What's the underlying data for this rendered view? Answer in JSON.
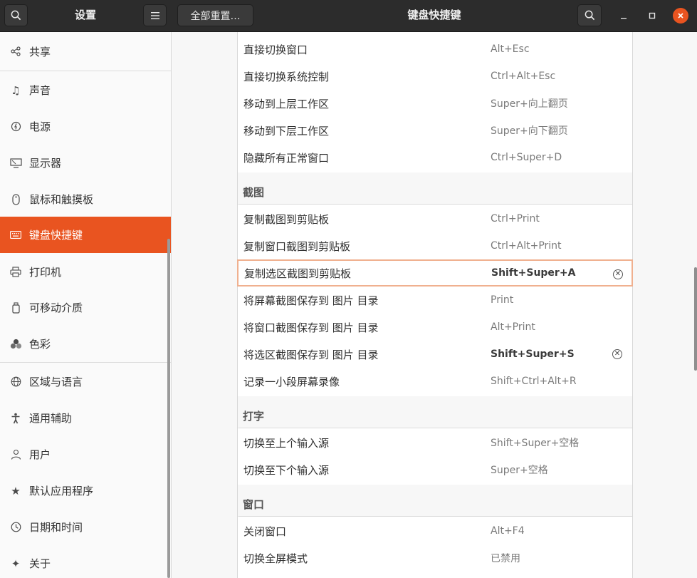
{
  "header": {
    "settings_title": "设置",
    "reset_button": "全部重置…",
    "page_title": "键盘快捷键"
  },
  "sidebar": {
    "items": [
      {
        "label": "共享",
        "icon": "share-icon"
      },
      {
        "label": "声音",
        "icon": "music-note-icon"
      },
      {
        "label": "电源",
        "icon": "power-icon"
      },
      {
        "label": "显示器",
        "icon": "display-icon"
      },
      {
        "label": "鼠标和触摸板",
        "icon": "mouse-icon"
      },
      {
        "label": "键盘快捷键",
        "icon": "keyboard-icon",
        "active": true
      },
      {
        "label": "打印机",
        "icon": "printer-icon"
      },
      {
        "label": "可移动介质",
        "icon": "removable-media-icon"
      },
      {
        "label": "色彩",
        "icon": "color-icon"
      },
      {
        "label": "区域与语言",
        "icon": "globe-icon"
      },
      {
        "label": "通用辅助",
        "icon": "accessibility-icon"
      },
      {
        "label": "用户",
        "icon": "user-icon"
      },
      {
        "label": "默认应用程序",
        "icon": "star-icon"
      },
      {
        "label": "日期和时间",
        "icon": "clock-icon"
      },
      {
        "label": "关于",
        "icon": "sparkle-icon"
      }
    ]
  },
  "shortcuts": {
    "top_rows": [
      {
        "name": "直接切换窗口",
        "key": "Alt+Esc"
      },
      {
        "name": "直接切换系统控制",
        "key": "Ctrl+Alt+Esc"
      },
      {
        "name": "移动到上层工作区",
        "key": "Super+向上翻页"
      },
      {
        "name": "移动到下层工作区",
        "key": "Super+向下翻页"
      },
      {
        "name": "隐藏所有正常窗口",
        "key": "Ctrl+Super+D"
      }
    ],
    "screenshot_section": "截图",
    "screenshot_rows": [
      {
        "name": "复制截图到剪贴板",
        "key": "Ctrl+Print"
      },
      {
        "name": "复制窗口截图到剪贴板",
        "key": "Ctrl+Alt+Print"
      },
      {
        "name": "复制选区截图到剪贴板",
        "key": "Shift+Super+A",
        "custom": true,
        "selected": true
      },
      {
        "name": "将屏幕截图保存到 图片 目录",
        "key": "Print"
      },
      {
        "name": "将窗口截图保存到 图片 目录",
        "key": "Alt+Print"
      },
      {
        "name": "将选区截图保存到 图片 目录",
        "key": "Shift+Super+S",
        "custom": true
      },
      {
        "name": "记录一小段屏幕录像",
        "key": "Shift+Ctrl+Alt+R"
      }
    ],
    "typing_section": "打字",
    "typing_rows": [
      {
        "name": "切换至上个输入源",
        "key": "Shift+Super+空格"
      },
      {
        "name": "切换至下个输入源",
        "key": "Super+空格"
      }
    ],
    "windows_section": "窗口",
    "windows_rows": [
      {
        "name": "关闭窗口",
        "key": "Alt+F4"
      },
      {
        "name": "切换全屏模式",
        "key": "已禁用"
      }
    ]
  },
  "colors": {
    "accent": "#e95420",
    "header_bg": "#2c2c2c",
    "selected_border": "#f0b08f"
  }
}
